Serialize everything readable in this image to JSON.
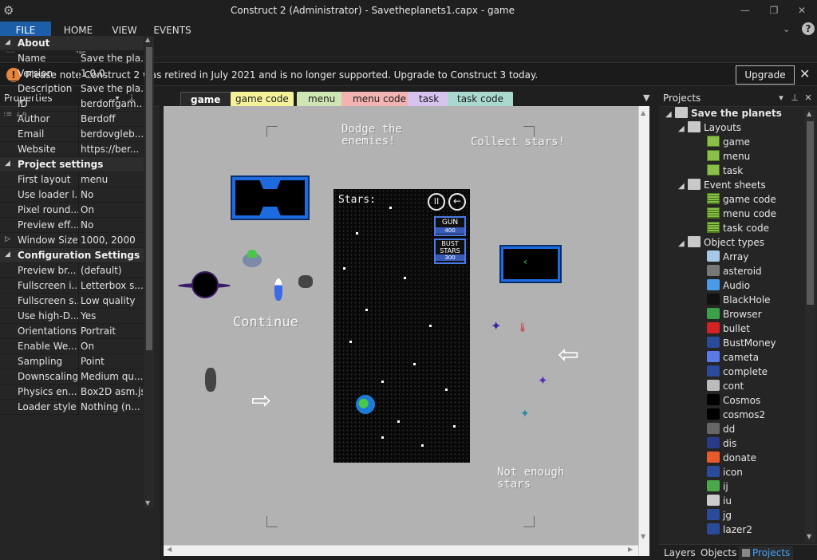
{
  "window": {
    "title": "Construct 2 (Administrator) - Savetheplanets1.capx - game",
    "controls": [
      "minimize-icon",
      "restore-icon",
      "close-icon"
    ]
  },
  "ribbon": {
    "tabs": [
      {
        "label": "FILE",
        "active": true
      },
      {
        "label": "HOME",
        "active": false
      },
      {
        "label": "VIEW",
        "active": false
      },
      {
        "label": "EVENTS",
        "active": false
      }
    ]
  },
  "notice": {
    "text": "Please note Construct 2 was retired in July 2021 and is no longer supported. Upgrade to Construct 3 today.",
    "button": "Upgrade"
  },
  "properties": {
    "title": "Properties",
    "sections": [
      {
        "label": "About",
        "rows": [
          {
            "k": "Name",
            "v": "Save the pla..."
          },
          {
            "k": "Version",
            "v": "1.0.0"
          },
          {
            "k": "Description",
            "v": "Save the pla..."
          },
          {
            "k": "ID",
            "v": "berdoffgam..."
          },
          {
            "k": "Author",
            "v": "Berdoff"
          },
          {
            "k": "Email",
            "v": "berdovgleb..."
          },
          {
            "k": "Website",
            "v": "https://ber..."
          }
        ]
      },
      {
        "label": "Project settings",
        "rows": [
          {
            "k": "First layout",
            "v": "menu"
          },
          {
            "k": "Use loader l...",
            "v": "No"
          },
          {
            "k": "Pixel round...",
            "v": "On"
          },
          {
            "k": "Preview eff...",
            "v": "No"
          },
          {
            "k": "Window Size",
            "v": "1000, 2000",
            "expandable": true
          }
        ]
      },
      {
        "label": "Configuration Settings",
        "rows": [
          {
            "k": "Preview br...",
            "v": "(default)"
          },
          {
            "k": "Fullscreen i...",
            "v": "Letterbox s..."
          },
          {
            "k": "Fullscreen s...",
            "v": "Low quality"
          },
          {
            "k": "Use high-D...",
            "v": "Yes"
          },
          {
            "k": "Orientations",
            "v": "Portrait"
          },
          {
            "k": "Enable We...",
            "v": "On"
          },
          {
            "k": "Sampling",
            "v": "Point"
          },
          {
            "k": "Downscaling",
            "v": "Medium qu..."
          },
          {
            "k": "Physics en...",
            "v": "Box2D asm.js"
          },
          {
            "k": "Loader style",
            "v": "Nothing (n..."
          }
        ]
      }
    ]
  },
  "editor": {
    "tabs": [
      {
        "label": "game",
        "color": "#2a2a2a",
        "active": true
      },
      {
        "label": "game code",
        "color": "#f6f29a"
      },
      {
        "label": "menu",
        "color": "#cfe6b4"
      },
      {
        "label": "menu code",
        "color": "#f4b3b3"
      },
      {
        "label": "task",
        "color": "#d6c3ee"
      },
      {
        "label": "task code",
        "color": "#a9d8cf"
      }
    ],
    "canvas_text": {
      "dodge": "Dodge the enemies!",
      "collect": "Collect stars!",
      "stars": "Stars:",
      "continue": "Continue",
      "not_enough": "Not enough stars",
      "gun": "GUN",
      "gun_price": "400",
      "bust": "BUST STARS",
      "bust_price": "300"
    }
  },
  "projects": {
    "title": "Projects",
    "root": "Save the planets",
    "folders": [
      {
        "label": "Layouts",
        "items": [
          "game",
          "menu",
          "task"
        ],
        "type": "layout"
      },
      {
        "label": "Event sheets",
        "items": [
          "game code",
          "menu code",
          "task code"
        ],
        "type": "sheet"
      },
      {
        "label": "Object types",
        "type": "object",
        "items": [
          {
            "name": "Array",
            "icon": "grid-icon",
            "color": "#a8c8e8"
          },
          {
            "name": "asteroid",
            "icon": "asteroid-icon",
            "color": "#777777"
          },
          {
            "name": "Audio",
            "icon": "speaker-icon",
            "color": "#4a9ae8"
          },
          {
            "name": "BlackHole",
            "icon": "black-hole-icon",
            "color": "#111111"
          },
          {
            "name": "Browser",
            "icon": "globe-icon",
            "color": "#3aa04a"
          },
          {
            "name": "bullet",
            "icon": "bullet-icon",
            "color": "#d22222"
          },
          {
            "name": "BustMoney",
            "icon": "bust-money-icon",
            "color": "#2a4a9a"
          },
          {
            "name": "cameta",
            "icon": "comet-icon",
            "color": "#5a7ae8"
          },
          {
            "name": "complete",
            "icon": "complete-icon",
            "color": "#2a4a9a"
          },
          {
            "name": "cont",
            "icon": "cont-icon",
            "color": "#bbbbbb"
          },
          {
            "name": "Cosmos",
            "icon": "cosmos-icon",
            "color": "#000000"
          },
          {
            "name": "cosmos2",
            "icon": "cosmos2-icon",
            "color": "#000000"
          },
          {
            "name": "dd",
            "icon": "dd-icon",
            "color": "#666666"
          },
          {
            "name": "dis",
            "icon": "dis-icon",
            "color": "#2a3a8a"
          },
          {
            "name": "donate",
            "icon": "donate-icon",
            "color": "#e85a2a"
          },
          {
            "name": "icon",
            "icon": "icon-icon",
            "color": "#2a4a9a"
          },
          {
            "name": "ij",
            "icon": "ij-icon",
            "color": "#4aa84a"
          },
          {
            "name": "iu",
            "icon": "iu-icon",
            "color": "#cccccc"
          },
          {
            "name": "jg",
            "icon": "jg-icon",
            "color": "#2a4a9a"
          },
          {
            "name": "lazer2",
            "icon": "lazer-icon",
            "color": "#2a4a9a"
          }
        ]
      }
    ],
    "bottom_tabs": [
      {
        "label": "Layers",
        "active": false
      },
      {
        "label": "Objects",
        "active": false
      },
      {
        "label": "Projects",
        "active": true
      }
    ]
  }
}
